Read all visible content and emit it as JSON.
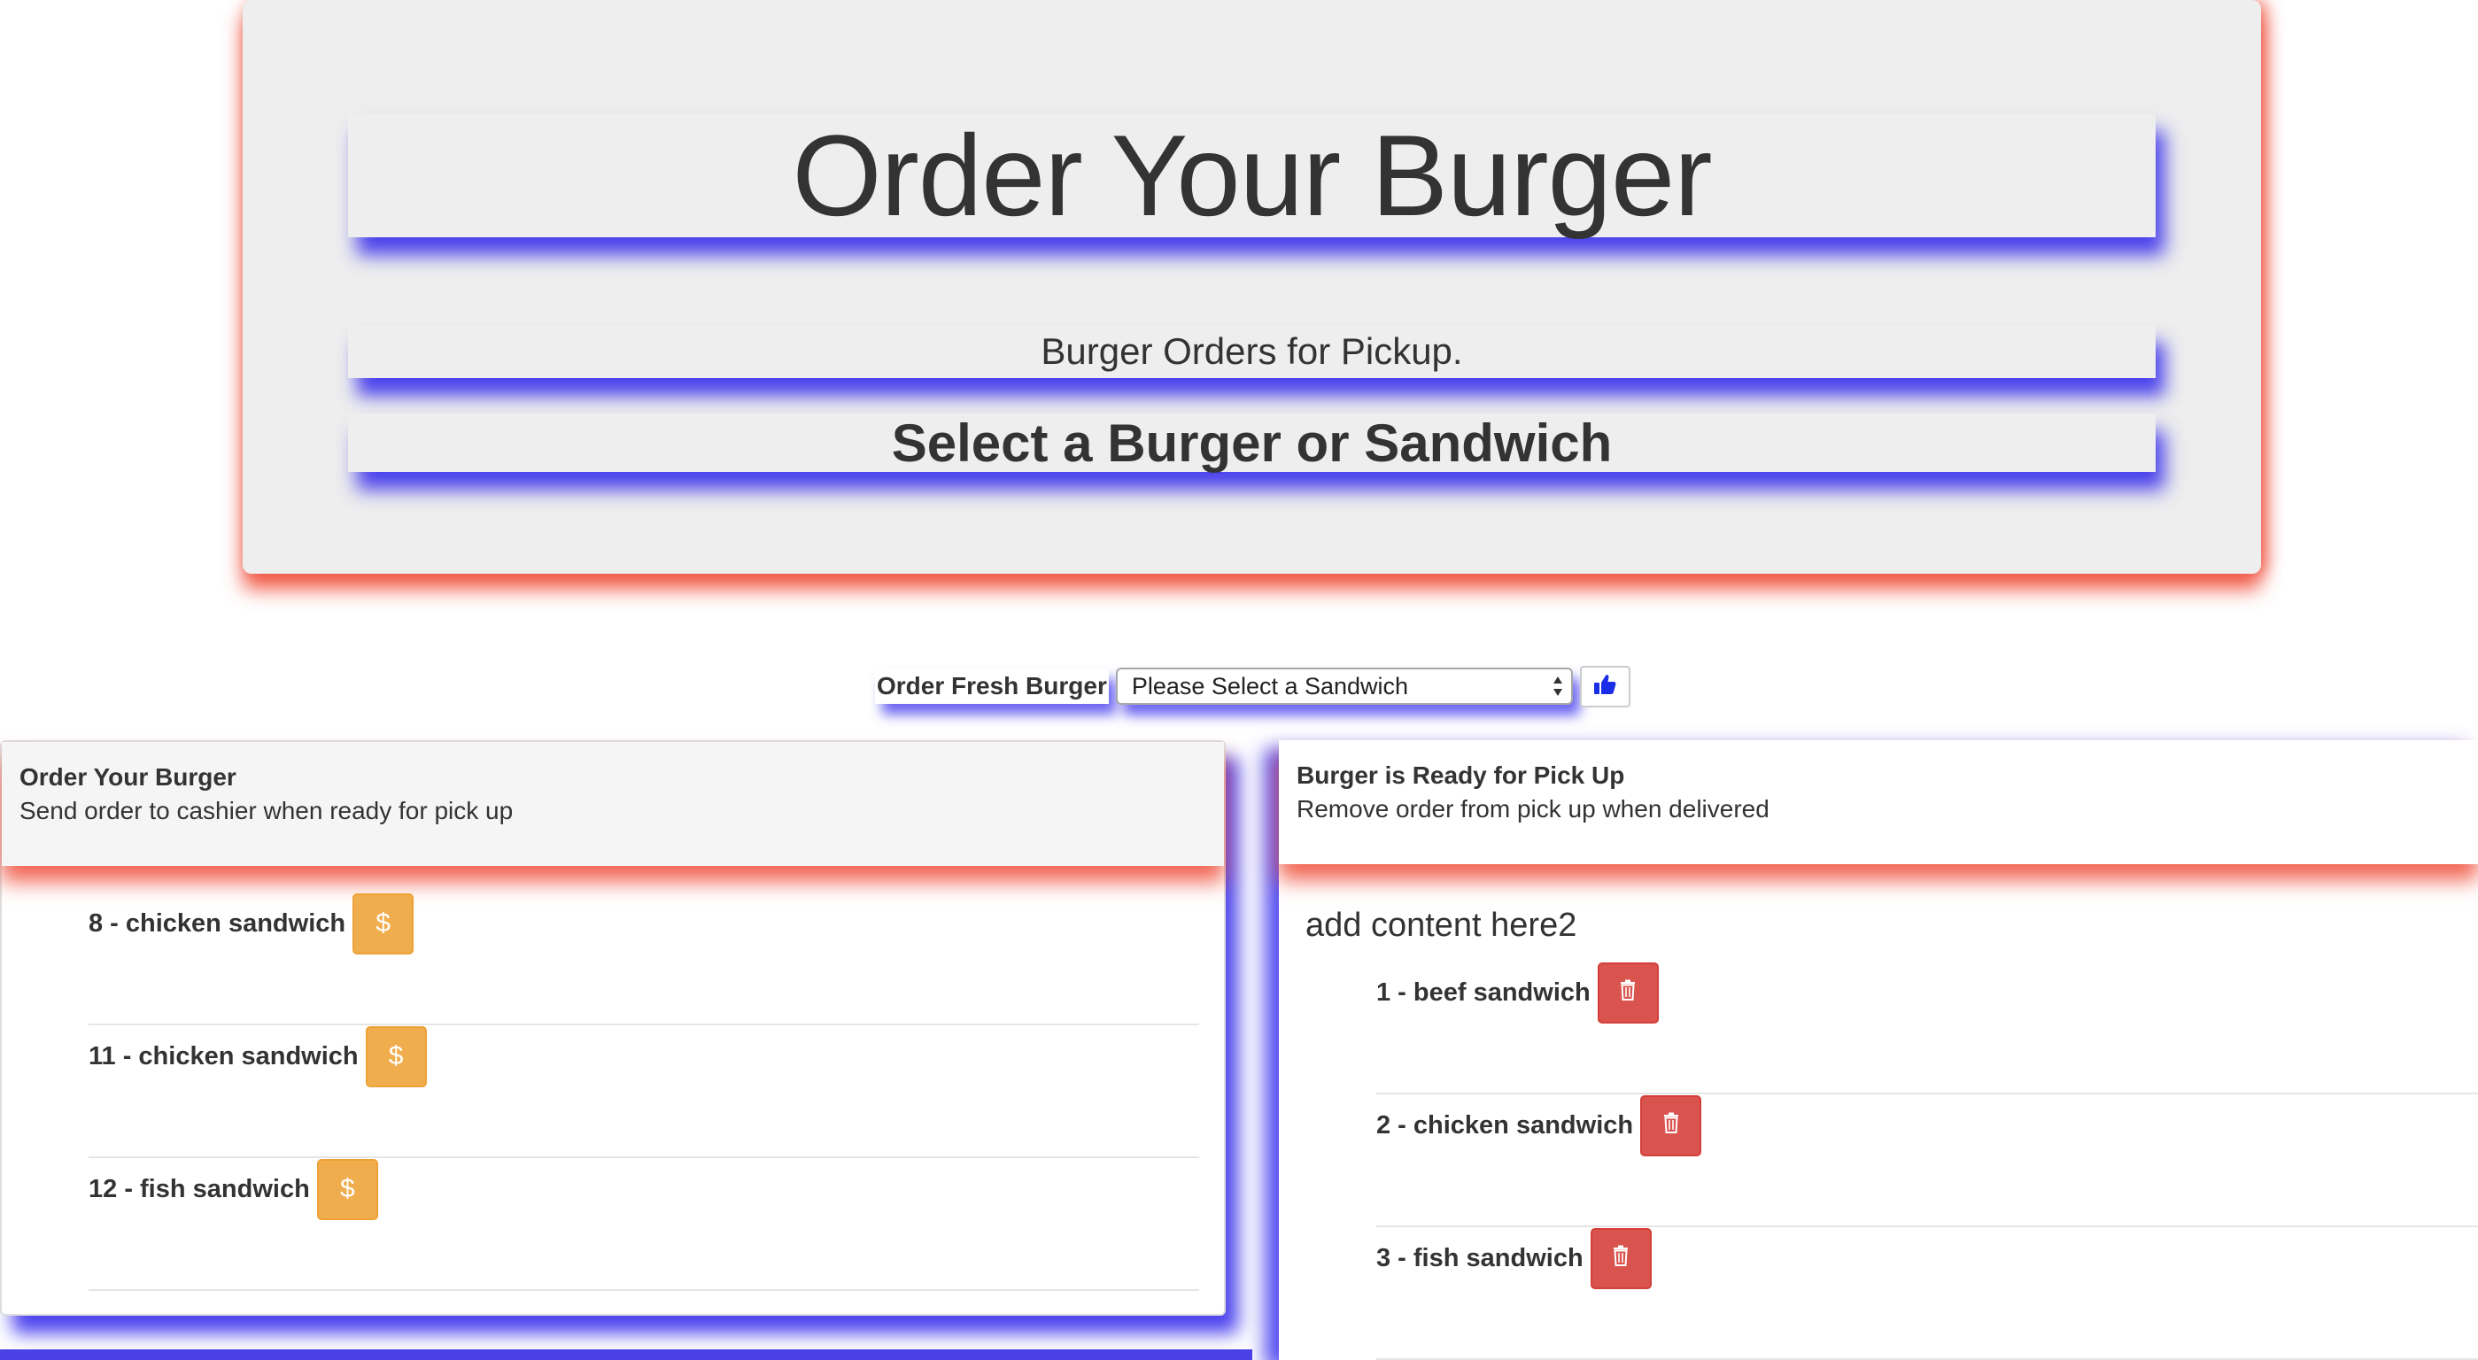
{
  "header": {
    "title": "Order Your Burger",
    "subtitle": "Burger Orders for Pickup.",
    "prompt": "Select a Burger or Sandwich"
  },
  "order_form": {
    "label": "Order Fresh Burger",
    "select_value": "Please Select a Sandwich",
    "submit_icon": "thumbs-up-icon"
  },
  "left_panel": {
    "title": "Order Your Burger",
    "subtitle": "Send order to cashier when ready for pick up",
    "items": [
      {
        "label": "8 - chicken sandwich",
        "button_icon": "dollar-icon",
        "button_text": "$"
      },
      {
        "label": "11 - chicken sandwich",
        "button_icon": "dollar-icon",
        "button_text": "$"
      },
      {
        "label": "12 - fish sandwich",
        "button_icon": "dollar-icon",
        "button_text": "$"
      }
    ]
  },
  "right_panel": {
    "title": "Burger is Ready for Pick Up",
    "subtitle": "Remove order from pick up when delivered",
    "content_heading": "add content here2",
    "items": [
      {
        "label": "1 - beef sandwich",
        "button_icon": "trash-icon"
      },
      {
        "label": "2 - chicken sandwich",
        "button_icon": "trash-icon"
      },
      {
        "label": "3 - fish sandwich",
        "button_icon": "trash-icon"
      }
    ]
  },
  "colors": {
    "jumbotron_bg": "#eeeeee",
    "red_shadow": "#f04b37",
    "blue_shadow": "#2d23eb",
    "warning_button": "#f0ad4e",
    "danger_button": "#d9534f",
    "thumb_icon": "#1a2ee8"
  }
}
